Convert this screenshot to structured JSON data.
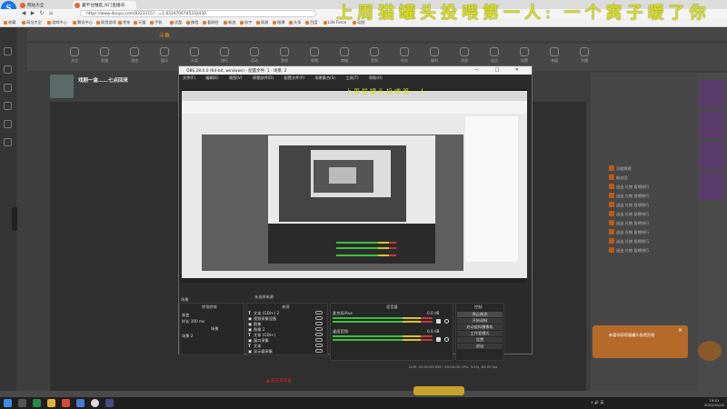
{
  "browser": {
    "tabs": [
      "网站大全",
      "藏不住懵晨_N门直播间"
    ],
    "url": "https://www.douyu.com/8323115?...=1.6334706745332430",
    "bookmarks": [
      "收藏",
      "网址大全",
      "游戏中心",
      "腾讯中心",
      "网贷游戏",
      "京东",
      "天猫",
      "手机",
      "优酷",
      "携程",
      "看财经",
      "新浪",
      "苏宁",
      "网易",
      "微博",
      "头条",
      "百度",
      "Life Force",
      "动图"
    ],
    "nav_buttons": [
      "◀",
      "▶",
      "↻",
      "⌂"
    ]
  },
  "overlay_title": "上周猫罐头投喂第一人: 一个窝子暖了你",
  "site": {
    "logo": "斗鱼",
    "nav_items": [
      "关注",
      "直播",
      "游戏",
      "娱乐",
      "分类",
      "排行",
      "活动",
      "鱼吧",
      "视频",
      "商城",
      "签到",
      "任务",
      "福利",
      "消息",
      "会员",
      "设置",
      "充值",
      "开播"
    ],
    "streamer_title": "戏剧一盒……七点回来",
    "right_panel_rows": [
      "贡献周榜",
      "粉丝团",
      "送出 礼物 投喂排行",
      "送出 礼物 投喂排行",
      "送出 礼物 投喂排行",
      "送出 礼物 投喂排行",
      "送出 礼物 投喂排行",
      "送出 礼物 投喂排行",
      "送出 礼物 投喂排行",
      "送出 礼物 投喂排行"
    ],
    "tip_text": "恭喜你获得猫罐头投喂资格",
    "pink_text": "▲ 双击有惊喜"
  },
  "obs": {
    "title": "OBS 28.0.0 (64-bit, windows) - 配置文件: 1 - 场景: 2",
    "window_controls": "— □ ✕",
    "menus": [
      "文件(F)",
      "编辑(E)",
      "视图(V)",
      "停靠部件(D)",
      "配置文件(P)",
      "场景集合(S)",
      "工具(T)",
      "帮助(H)"
    ],
    "nested_overlay": "上周猫罐头投喂第一人",
    "dock_labels": {
      "scenes": "场景",
      "sources": "来源",
      "mixer": "混音器",
      "transitions": "转场特效",
      "controls": "控制",
      "no_source": "未选择来源"
    },
    "scene_rows": [
      "场景",
      "场景 2"
    ],
    "properties_rows": [
      "渐变",
      "时长 300 ms"
    ],
    "sources": [
      {
        "icon": "T",
        "name": "文本 (GDI+) 2"
      },
      {
        "icon": "▣",
        "name": "视频采集设备"
      },
      {
        "icon": "▣",
        "name": "图像"
      },
      {
        "icon": "▣",
        "name": "图像 2"
      },
      {
        "icon": "T",
        "name": "文本 (GDI+)"
      },
      {
        "icon": "▣",
        "name": "窗口采集"
      },
      {
        "icon": "T",
        "name": "文本"
      },
      {
        "icon": "▣",
        "name": "显示器采集"
      }
    ],
    "mixer": [
      {
        "name": "麦克风/Aux",
        "db": "0.0 dB"
      },
      {
        "name": "桌面音频",
        "db": "0.0 dB"
      }
    ],
    "controls": [
      "停止推流",
      "开始录制",
      "启动虚拟摄像机",
      "工作室模式",
      "设置",
      "退出"
    ],
    "status": "LIVE: 00:00:00   REC: 00:00:00   CPU: 3.4%, 60.00 fps"
  },
  "taskbar": {
    "time": "19:01",
    "date": "2022/10/15",
    "tray": "∧ 🔊 英"
  }
}
